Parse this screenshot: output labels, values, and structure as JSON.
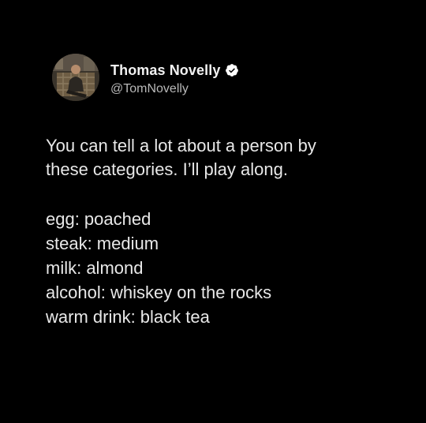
{
  "author": {
    "display_name": "Thomas Novelly",
    "handle": "@TomNovelly",
    "verified": true,
    "avatar_icon": "avatar-photo",
    "verified_icon": "verified-badge-icon"
  },
  "tweet": {
    "text_line_1": "You can tell a lot about a person by",
    "text_line_2": "these categories. I’ll play along.",
    "items": [
      "egg: poached",
      "steak: medium",
      "milk: almond",
      "alcohol: whiskey on the rocks",
      "warm drink: black tea"
    ]
  },
  "colors": {
    "background": "#000000",
    "text": "#e8e8e8",
    "handle": "#b8b8b8"
  }
}
